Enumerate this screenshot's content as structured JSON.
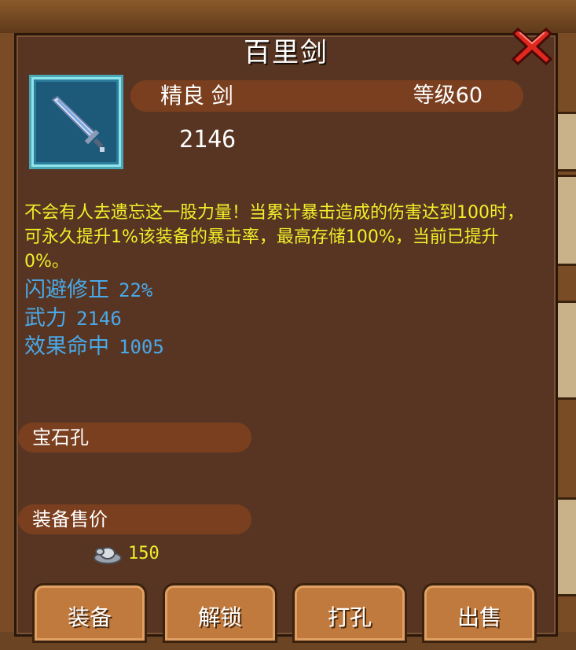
{
  "dialog": {
    "title": "百里剑"
  },
  "item": {
    "icon": "sword-icon",
    "rarity_label": "精良 剑",
    "level_label": "等级60",
    "power": "2146",
    "description": "不会有人去遗忘这一股力量！当累计暴击造成的伤害达到100时，可永久提升1%该装备的暴击率，最高存储100%，当前已提升0%。",
    "stats": [
      {
        "name": "闪避修正",
        "value": "22%"
      },
      {
        "name": "武力",
        "value": "2146"
      },
      {
        "name": "效果命中",
        "value": "1005"
      }
    ]
  },
  "sections": {
    "gem_slots_label": "宝石孔",
    "sell_price_label": "装备售价",
    "sell_price_value": "150",
    "currency_icon": "silver-ingot-icon"
  },
  "actions": {
    "equip": "装备",
    "unlock": "解锁",
    "punch_hole": "打孔",
    "sell": "出售"
  },
  "colors": {
    "panel_bg": "#573522",
    "pill_bg": "#7a3f1f",
    "description_text": "#f2ee2a",
    "stat_text": "#4aa8e8",
    "button_bg": "#c07a3e",
    "close_red": "#e0281f"
  }
}
